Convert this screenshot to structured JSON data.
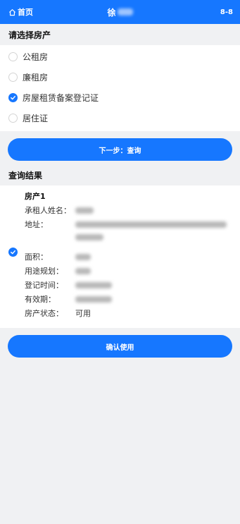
{
  "header": {
    "home_label": "首页",
    "user_name": "徐",
    "badge": "8-8"
  },
  "select_section": {
    "title": "请选择房产",
    "options": [
      {
        "label": "公租房",
        "checked": false
      },
      {
        "label": "廉租房",
        "checked": false
      },
      {
        "label": "房屋租赁备案登记证",
        "checked": true
      },
      {
        "label": "居住证",
        "checked": false
      }
    ]
  },
  "next_button": "下一步：查询",
  "result_section": {
    "title": "查询结果",
    "property_title": "房产1",
    "checked": true,
    "fields": [
      {
        "label": "承租人姓名：",
        "value": ""
      },
      {
        "label": "地址：",
        "value": ""
      },
      {
        "label": "面积：",
        "value": ""
      },
      {
        "label": "用途规划：",
        "value": ""
      },
      {
        "label": "登记时间：",
        "value": ""
      },
      {
        "label": "有效期：",
        "value": ""
      },
      {
        "label": "房产状态：",
        "value": "可用"
      }
    ]
  },
  "confirm_button": "确认使用",
  "colors": {
    "primary": "#1677ff",
    "background": "#f0f1f3"
  }
}
